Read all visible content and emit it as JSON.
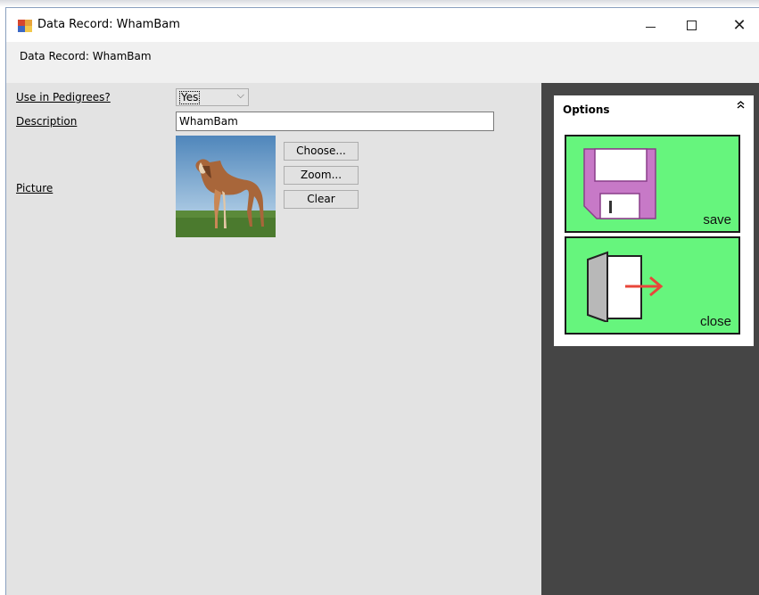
{
  "window": {
    "title": "Data Record: WhamBam",
    "controls": {
      "minimize_icon": "minimize-icon",
      "maximize_icon": "maximize-icon",
      "close_icon": "close-icon",
      "close_glyph": "✕"
    }
  },
  "header": {
    "text": "Data Record: WhamBam"
  },
  "form": {
    "use_in_pedigrees": {
      "label": "Use in Pedigrees?",
      "value": "Yes",
      "arrow": "⌵"
    },
    "description": {
      "label": "Description",
      "value": "WhamBam"
    },
    "picture": {
      "label": "Picture",
      "buttons": {
        "choose": "Choose...",
        "zoom": "Zoom...",
        "clear": "Clear"
      }
    }
  },
  "options": {
    "title": "Options",
    "collapse_glyph": "≪",
    "tiles": [
      {
        "label": "save",
        "icon": "floppy-disk-icon",
        "color": "#66f57d"
      },
      {
        "label": "close",
        "icon": "exit-door-icon",
        "color": "#66f57d"
      }
    ]
  },
  "colors": {
    "form_background": "#e3e3e3",
    "right_pane_background": "#454545",
    "tile_green": "#66f57d",
    "floppy_purple": "#c779c7",
    "exit_arrow_red": "#e8463a"
  }
}
